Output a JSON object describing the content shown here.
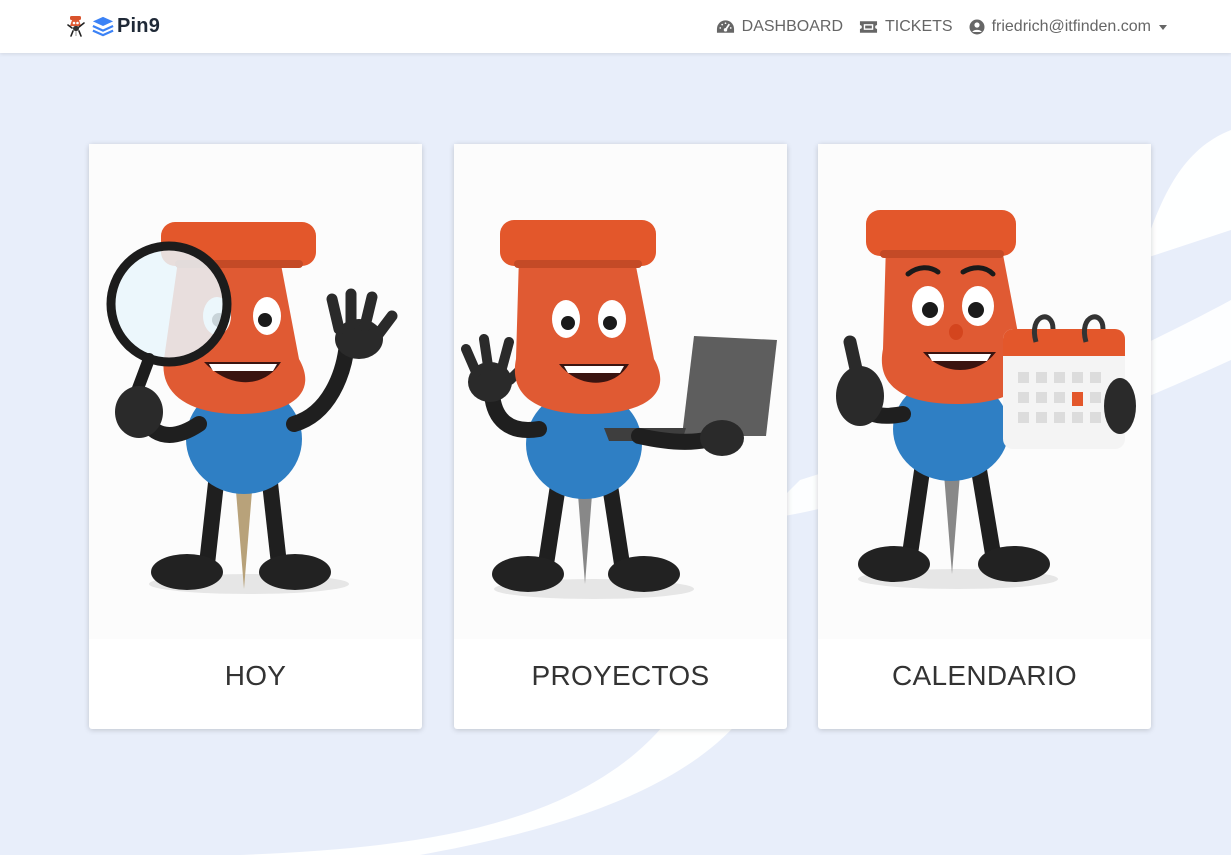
{
  "app": {
    "brand_name": "Pin9"
  },
  "nav": {
    "dashboard_label": "DASHBOARD",
    "tickets_label": "TICKETS",
    "user_email": "friedrich@itfinden.com"
  },
  "cards": [
    {
      "title": "HOY",
      "illustration": "magnifier-mascot"
    },
    {
      "title": "PROYECTOS",
      "illustration": "laptop-mascot"
    },
    {
      "title": "CALENDARIO",
      "illustration": "calendar-mascot"
    }
  ],
  "colors": {
    "background": "#e8eefa",
    "pin_head": "#e05a33",
    "pin_body": "#2f7fc4",
    "brand_blue": "#3b82f6"
  }
}
